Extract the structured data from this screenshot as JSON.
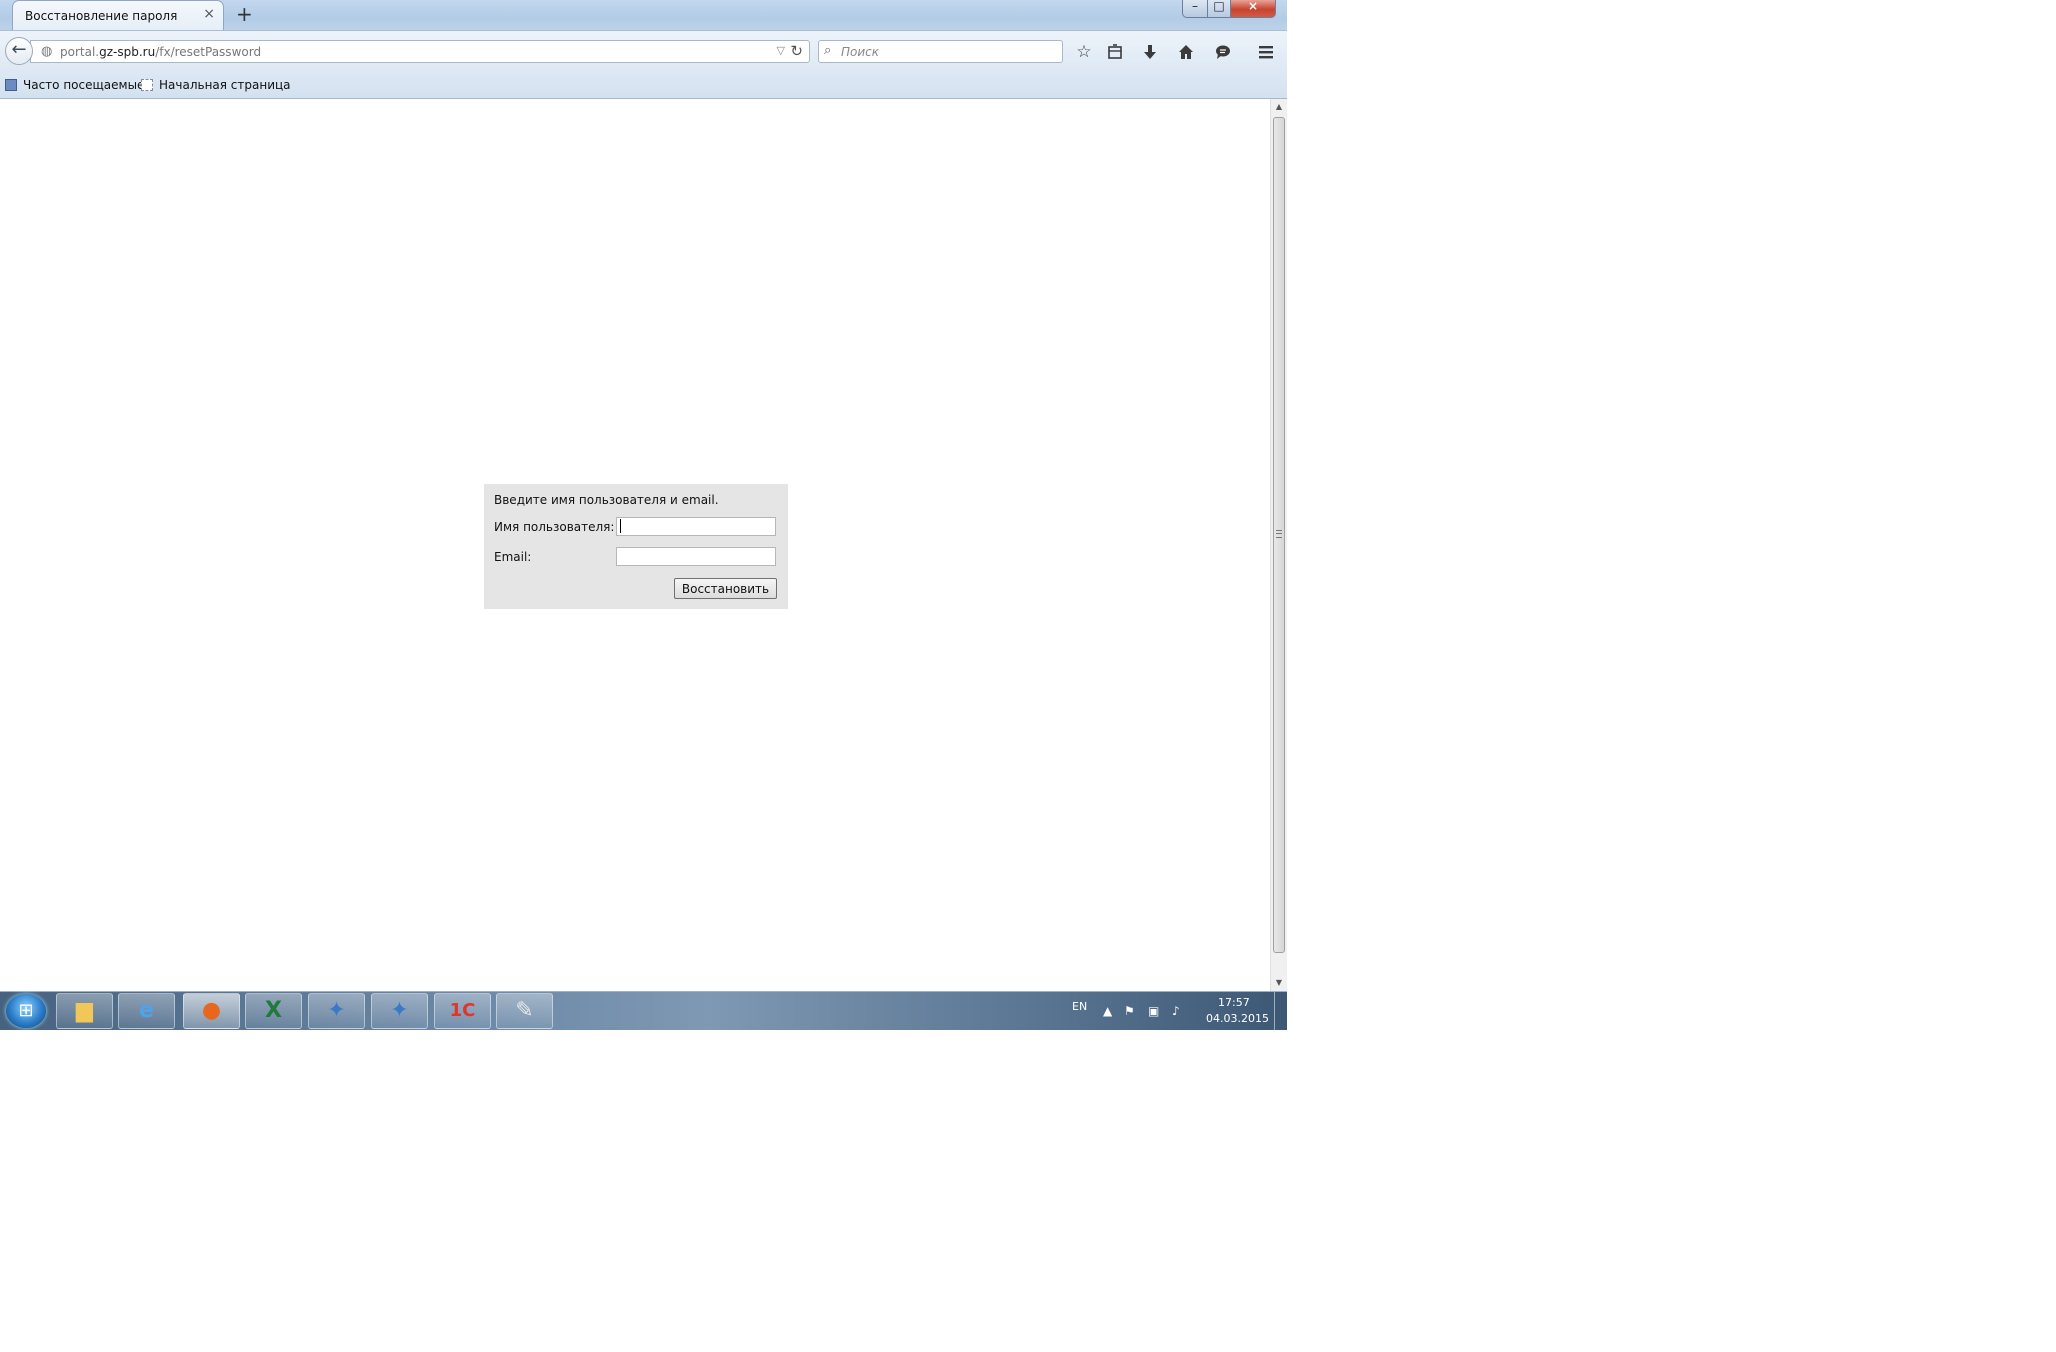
{
  "browser": {
    "tab_title": "Восстановление пароля",
    "tab_close": "×",
    "new_tab": "+",
    "window_controls": {
      "minimize": "–",
      "maximize": "□",
      "close": "×"
    },
    "nav": {
      "back_glyph": "←",
      "url_prefix": "portal.",
      "url_domain": "gz-spb.ru",
      "url_path": "/fx/resetPassword",
      "search_placeholder": "Поиск",
      "toolbar_icons": [
        "star-icon",
        "reading-list-icon",
        "download-icon",
        "home-icon",
        "chat-icon",
        "menu-icon"
      ]
    },
    "bookmarks": [
      {
        "label": "Часто посещаемые",
        "icon": "frequent-icon"
      },
      {
        "label": "Начальная страница",
        "icon": "page-icon"
      }
    ]
  },
  "form": {
    "intro": "Введите имя пользователя и email.",
    "username_label": "Имя пользователя:",
    "username_value": "",
    "email_label": "Email:",
    "email_value": "",
    "submit_label": "Восстановить"
  },
  "taskbar": {
    "apps": [
      "explorer-icon",
      "internet-explorer-icon",
      "firefox-icon",
      "excel-icon",
      "network-app-icon",
      "network-app-icon",
      "1c-icon",
      "paint-icon"
    ],
    "active_app": "firefox-icon",
    "language": "EN",
    "time": "17:57",
    "date": "04.03.2015"
  },
  "colors": {
    "form_background": "#e5e5e5",
    "titlebar": "#c3d8ee",
    "close_button": "#c7442f"
  }
}
